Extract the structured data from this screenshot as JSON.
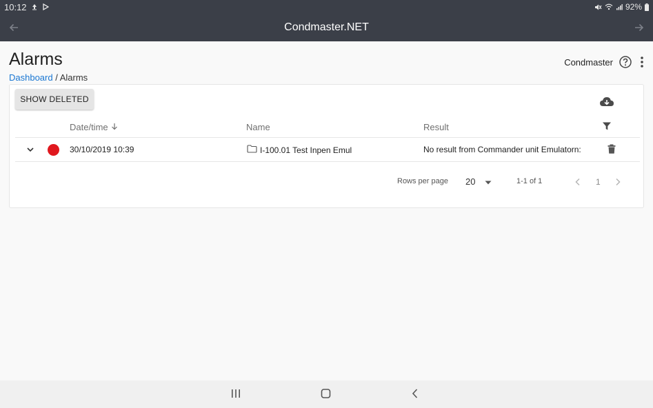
{
  "status_bar": {
    "time": "10:12",
    "battery": "92%"
  },
  "app_bar": {
    "title": "Condmaster.NET"
  },
  "page": {
    "title": "Alarms",
    "breadcrumb": {
      "link": "Dashboard",
      "separator": " / ",
      "current": "Alarms"
    },
    "user": "Condmaster"
  },
  "toolbar": {
    "show_deleted_label": "SHOW DELETED"
  },
  "table": {
    "columns": {
      "date": "Date/time",
      "name": "Name",
      "result": "Result"
    },
    "rows": [
      {
        "date": "30/10/2019 10:39",
        "name": "I-100.01 Test Inpen Emul",
        "result": "No result from Commander unit Emulatorn:",
        "status_color": "#e0181e"
      }
    ]
  },
  "pagination": {
    "rows_per_page_label": "Rows per page",
    "rows_per_page": "20",
    "range": "1-1 of 1",
    "page": "1"
  },
  "icons": {
    "status_bar": [
      "upload-icon",
      "play-store-icon",
      "mute-icon",
      "wifi-icon",
      "signal-icon",
      "battery-icon"
    ],
    "header": [
      "back-arrow-icon",
      "forward-arrow-icon",
      "help-icon",
      "more-vert-icon",
      "cloud-download-icon",
      "filter-icon"
    ],
    "row": [
      "chevron-down-icon",
      "folder-icon",
      "delete-icon"
    ],
    "nav": [
      "recents-icon",
      "home-icon",
      "system-back-icon"
    ]
  }
}
